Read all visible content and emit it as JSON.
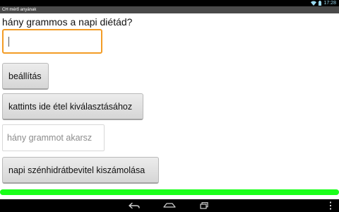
{
  "status_bar": {
    "time": "17:28",
    "icons": [
      "wifi-icon",
      "battery-icon"
    ]
  },
  "app": {
    "title": "CH mérő anyának"
  },
  "form": {
    "question": "hány grammos a napi diétád?",
    "daily_grams_value": "",
    "settings_label": "beállítás",
    "select_food_label": "kattints ide étel kiválasztásához",
    "grams_placeholder": "hány grammot akarsz",
    "calculate_label": "napi szénhidrátbevitel kiszámolása"
  },
  "progress": {
    "fraction": 1.0,
    "color": "#19ff19"
  },
  "nav": {
    "icons": [
      "back-icon",
      "home-icon",
      "recents-icon",
      "menu-icon"
    ]
  }
}
